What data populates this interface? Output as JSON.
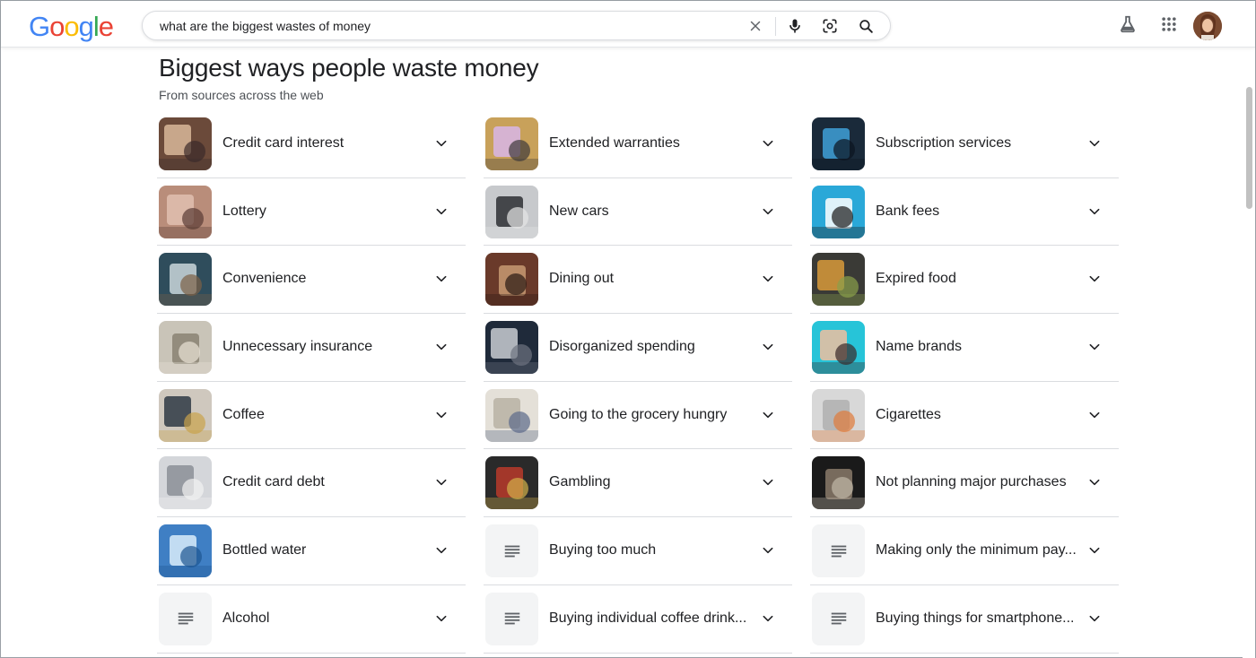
{
  "header": {
    "logo": [
      "G",
      "o",
      "o",
      "g",
      "l",
      "e"
    ],
    "logo_colors": [
      "#4285f4",
      "#ea4335",
      "#fbbc05",
      "#4285f4",
      "#34a853",
      "#ea4335"
    ],
    "search_value": "what are the biggest wastes of money",
    "icons": [
      "close-icon",
      "microphone-icon",
      "lens-camera-icon",
      "search-icon",
      "labs-flask-icon",
      "apps-grid-icon"
    ]
  },
  "results": {
    "title": "Biggest ways people waste money",
    "subtitle": "From sources across the web",
    "columns": [
      [
        {
          "label": "Credit card interest",
          "thumb": "image"
        },
        {
          "label": "Lottery",
          "thumb": "image"
        },
        {
          "label": "Convenience",
          "thumb": "image"
        },
        {
          "label": "Unnecessary insurance",
          "thumb": "image"
        },
        {
          "label": "Coffee",
          "thumb": "image"
        },
        {
          "label": "Credit card debt",
          "thumb": "image"
        },
        {
          "label": "Bottled water",
          "thumb": "image"
        },
        {
          "label": "Alcohol",
          "thumb": "doc"
        }
      ],
      [
        {
          "label": "Extended warranties",
          "thumb": "image"
        },
        {
          "label": "New cars",
          "thumb": "image"
        },
        {
          "label": "Dining out",
          "thumb": "image"
        },
        {
          "label": "Disorganized spending",
          "thumb": "image"
        },
        {
          "label": "Going to the grocery hungry",
          "thumb": "image"
        },
        {
          "label": "Gambling",
          "thumb": "image"
        },
        {
          "label": "Buying too much",
          "thumb": "doc"
        },
        {
          "label": "Buying individual coffee drink...",
          "thumb": "doc"
        }
      ],
      [
        {
          "label": "Subscription services",
          "thumb": "image"
        },
        {
          "label": "Bank fees",
          "thumb": "image"
        },
        {
          "label": "Expired food",
          "thumb": "image"
        },
        {
          "label": "Name brands",
          "thumb": "image"
        },
        {
          "label": "Cigarettes",
          "thumb": "image"
        },
        {
          "label": "Not planning major purchases",
          "thumb": "image"
        },
        {
          "label": "Making only the minimum pay...",
          "thumb": "doc"
        },
        {
          "label": "Buying things for smartphone...",
          "thumb": "doc"
        }
      ]
    ]
  }
}
